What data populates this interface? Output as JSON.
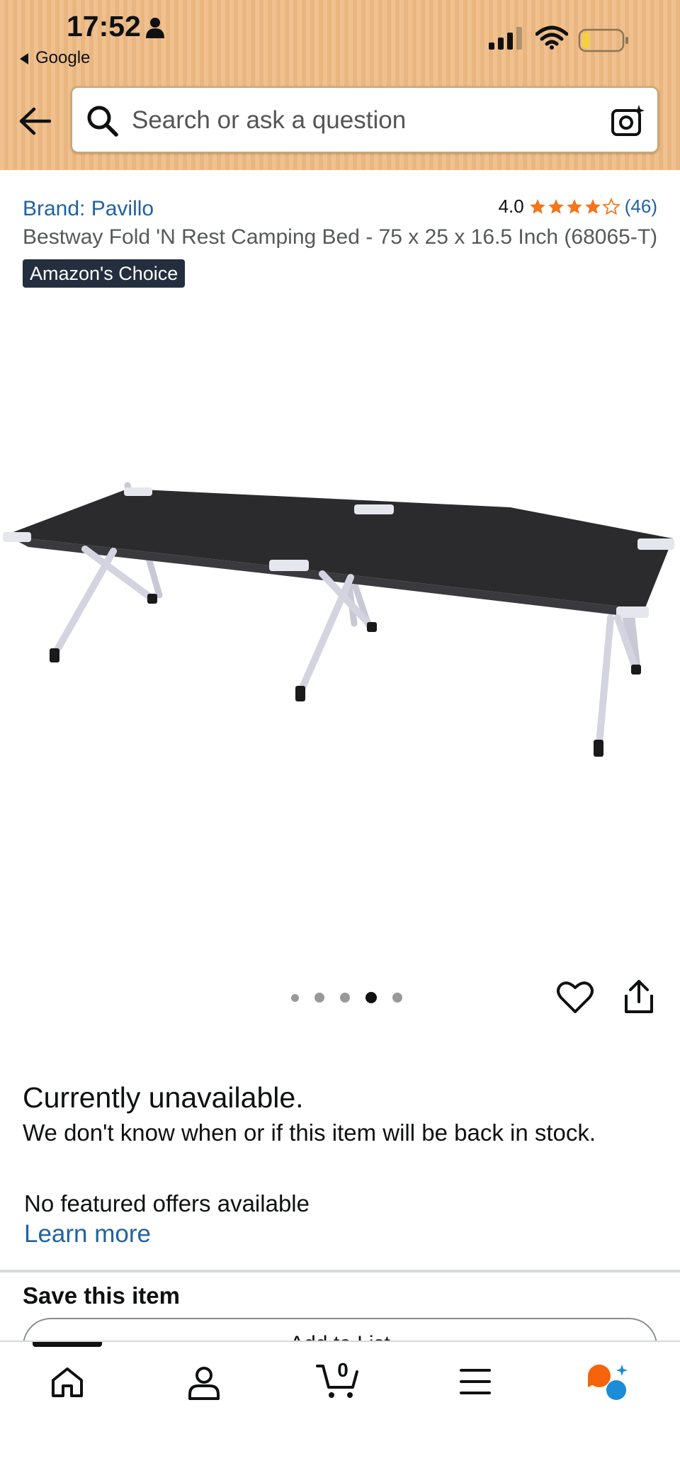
{
  "status_bar": {
    "time": "17:52",
    "back_app": "Google"
  },
  "search": {
    "placeholder": "Search or ask a question"
  },
  "product": {
    "brand": "Brand: Pavillo",
    "rating": "4.0",
    "stars": 4,
    "review_count": "(46)",
    "title": "Bestway Fold 'N Rest Camping Bed - 75 x 25 x 16.5 Inch (68065-T)",
    "badge": "Amazon's Choice",
    "image_count": 5,
    "active_image": 4
  },
  "availability": {
    "heading": "Currently unavailable.",
    "message": "We don't know when or if this item will be back in stock.",
    "no_offers": "No featured offers available",
    "learn_more": "Learn more"
  },
  "save": {
    "heading": "Save this item",
    "add_to_list": "Add to List"
  },
  "nav": {
    "cart_count": "0"
  },
  "colors": {
    "link": "#2162a1",
    "star": "#f3761b",
    "badge": "#232f3e",
    "header": "#f0c18f"
  },
  "icons": [
    "person-icon",
    "signal-icon",
    "wifi-icon",
    "battery-icon",
    "back-arrow-icon",
    "search-icon",
    "camera-icon",
    "heart-icon",
    "share-icon",
    "home-icon",
    "account-icon",
    "cart-icon",
    "menu-icon",
    "rufus-icon"
  ]
}
